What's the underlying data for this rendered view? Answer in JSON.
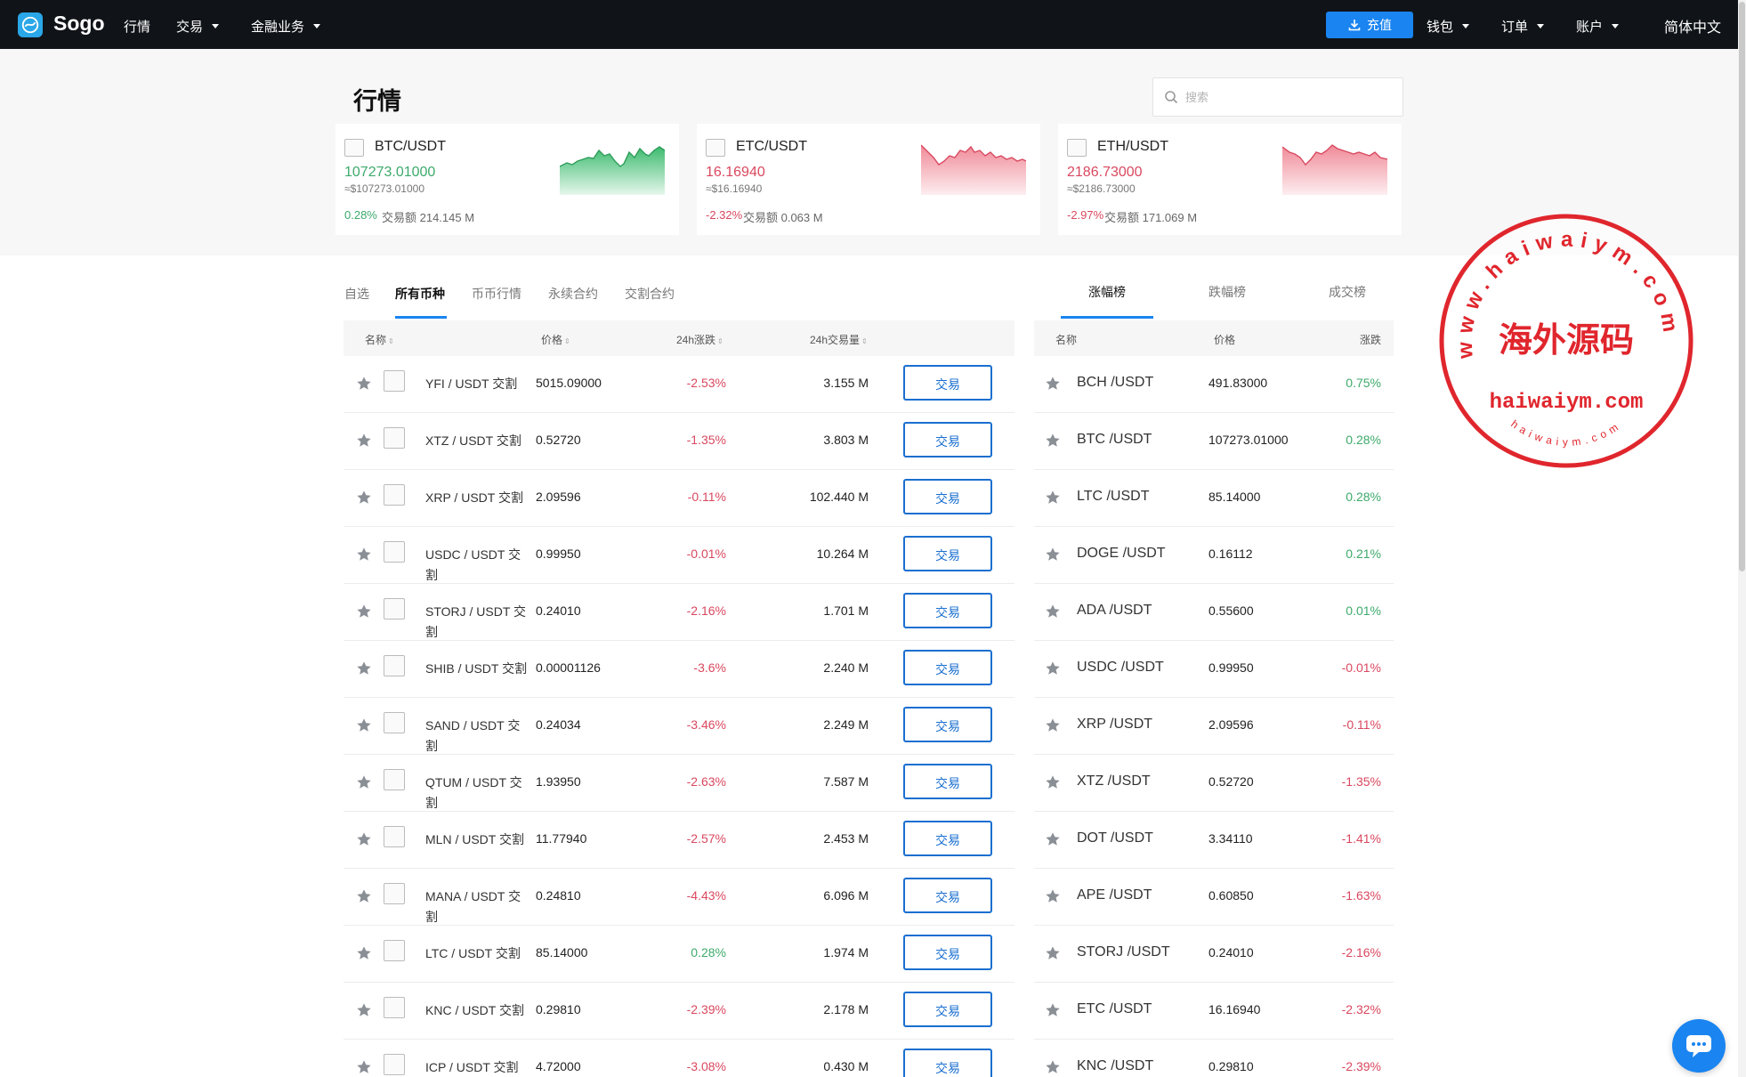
{
  "nav": {
    "brand": "Sogo",
    "items": [
      {
        "label": "行情"
      },
      {
        "label": "交易"
      },
      {
        "label": "金融业务"
      }
    ],
    "deposit_label": "充值",
    "right_items": [
      {
        "label": "钱包"
      },
      {
        "label": "订单"
      },
      {
        "label": "账户"
      }
    ],
    "language": "简体中文"
  },
  "page": {
    "title": "行情",
    "search_placeholder": "搜索"
  },
  "cards": [
    {
      "pair": "BTC/USDT",
      "price": "107273.01000",
      "usd": "≈$107273.01000",
      "change": "0.28%",
      "volume": "交易额 214.145 M",
      "trend": "up"
    },
    {
      "pair": "ETC/USDT",
      "price": "16.16940",
      "usd": "≈$16.16940",
      "change": "-2.32%",
      "volume": "交易额 0.063 M",
      "trend": "down"
    },
    {
      "pair": "ETH/USDT",
      "price": "2186.73000",
      "usd": "≈$2186.73000",
      "change": "-2.97%",
      "volume": "交易额 171.069 M",
      "trend": "down"
    }
  ],
  "tabs": [
    "自选",
    "所有币种",
    "币币行情",
    "永续合约",
    "交割合约"
  ],
  "table": {
    "headers": {
      "name": "名称",
      "price": "价格",
      "change": "24h涨跌",
      "volume": "24h交易量"
    },
    "trade_label": "交易",
    "rows": [
      {
        "name": "YFI / USDT 交割",
        "price": "5015.09000",
        "change": "-2.53%",
        "volume": "3.155 M"
      },
      {
        "name": "XTZ / USDT 交割",
        "price": "0.52720",
        "change": "-1.35%",
        "volume": "3.803 M"
      },
      {
        "name": "XRP / USDT 交割",
        "price": "2.09596",
        "change": "-0.11%",
        "volume": "102.440 M"
      },
      {
        "name": "USDC / USDT 交割",
        "price": "0.99950",
        "change": "-0.01%",
        "volume": "10.264 M"
      },
      {
        "name": "STORJ / USDT 交割",
        "price": "0.24010",
        "change": "-2.16%",
        "volume": "1.701 M"
      },
      {
        "name": "SHIB / USDT 交割",
        "price": "0.00001126",
        "change": "-3.6%",
        "volume": "2.240 M"
      },
      {
        "name": "SAND / USDT 交割",
        "price": "0.24034",
        "change": "-3.46%",
        "volume": "2.249 M"
      },
      {
        "name": "QTUM / USDT 交割",
        "price": "1.93950",
        "change": "-2.63%",
        "volume": "7.587 M"
      },
      {
        "name": "MLN / USDT 交割",
        "price": "11.77940",
        "change": "-2.57%",
        "volume": "2.453 M"
      },
      {
        "name": "MANA / USDT 交割",
        "price": "0.24810",
        "change": "-4.43%",
        "volume": "6.096 M"
      },
      {
        "name": "LTC / USDT 交割",
        "price": "85.14000",
        "change": "0.28%",
        "volume": "1.974 M"
      },
      {
        "name": "KNC / USDT 交割",
        "price": "0.29810",
        "change": "-2.39%",
        "volume": "2.178 M"
      },
      {
        "name": "ICP / USDT 交割",
        "price": "4.72000",
        "change": "-3.08%",
        "volume": "0.430 M"
      }
    ]
  },
  "ranking": {
    "tabs": [
      "涨幅榜",
      "跌幅榜",
      "成交榜"
    ],
    "headers": {
      "name": "名称",
      "price": "价格",
      "change": "涨跌"
    },
    "rows": [
      {
        "name": "BCH /USDT",
        "price": "491.83000",
        "change": "0.75%"
      },
      {
        "name": "BTC /USDT",
        "price": "107273.01000",
        "change": "0.28%"
      },
      {
        "name": "LTC /USDT",
        "price": "85.14000",
        "change": "0.28%"
      },
      {
        "name": "DOGE /USDT",
        "price": "0.16112",
        "change": "0.21%"
      },
      {
        "name": "ADA /USDT",
        "price": "0.55600",
        "change": "0.01%"
      },
      {
        "name": "USDC /USDT",
        "price": "0.99950",
        "change": "-0.01%"
      },
      {
        "name": "XRP /USDT",
        "price": "2.09596",
        "change": "-0.11%"
      },
      {
        "name": "XTZ /USDT",
        "price": "0.52720",
        "change": "-1.35%"
      },
      {
        "name": "DOT /USDT",
        "price": "3.34110",
        "change": "-1.41%"
      },
      {
        "name": "APE /USDT",
        "price": "0.60850",
        "change": "-1.63%"
      },
      {
        "name": "STORJ /USDT",
        "price": "0.24010",
        "change": "-2.16%"
      },
      {
        "name": "ETC /USDT",
        "price": "16.16940",
        "change": "-2.32%"
      },
      {
        "name": "KNC /USDT",
        "price": "0.29810",
        "change": "-2.39%"
      }
    ]
  },
  "watermark": {
    "top": "www.haiwaiym.com",
    "center": "海外源码",
    "domain": "haiwaiym.com",
    "bottom": "haiwaiym.com"
  },
  "colors": {
    "up": "#3daa6b",
    "down": "#d9485f",
    "accent": "#1a84f0"
  }
}
